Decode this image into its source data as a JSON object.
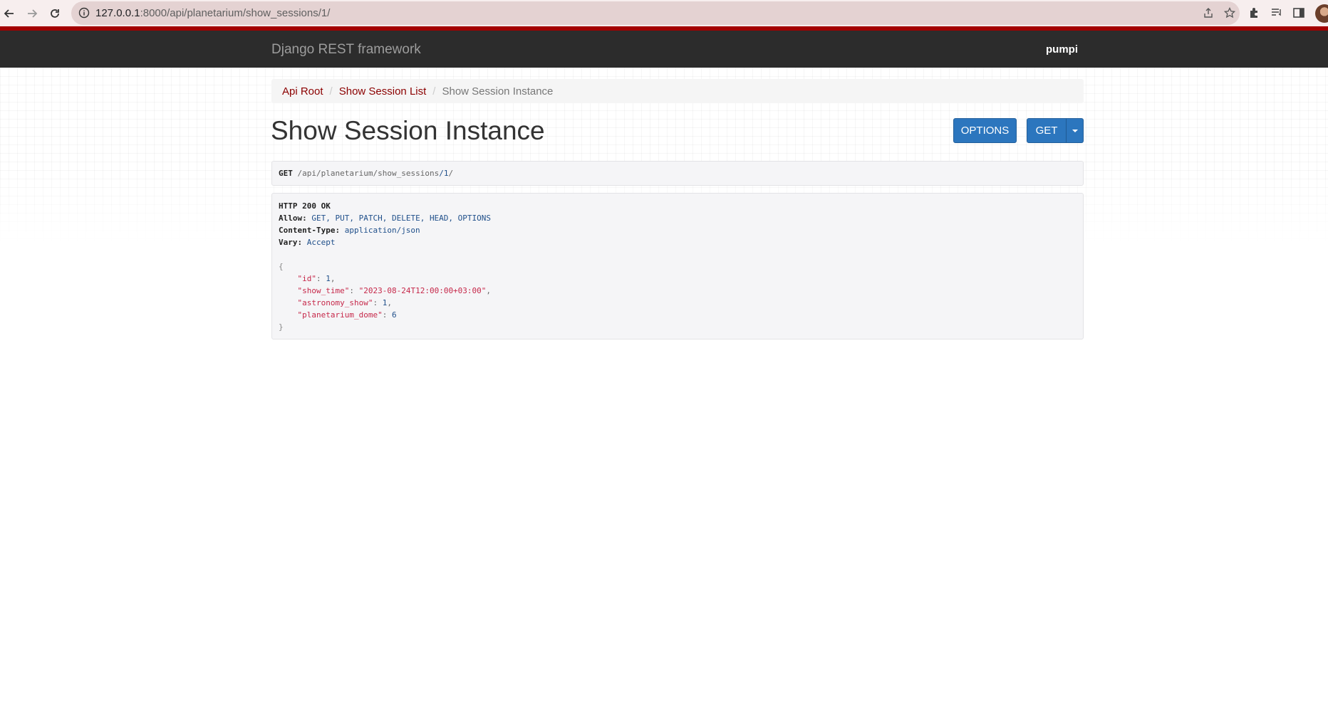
{
  "browser": {
    "url_host": "127.0.0.1",
    "url_rest": ":8000/api/planetarium/show_sessions/1/"
  },
  "navbar": {
    "brand": "Django REST framework",
    "user": "pumpi"
  },
  "breadcrumb": {
    "items": [
      {
        "label": "Api Root"
      },
      {
        "label": "Show Session List"
      }
    ],
    "separator": "/",
    "active": "Show Session Instance"
  },
  "page": {
    "title": "Show Session Instance"
  },
  "buttons": {
    "options": "OPTIONS",
    "get": "GET"
  },
  "request": {
    "method": "GET",
    "path_parts": [
      "/api",
      "/planetarium",
      "/show_sessions",
      "/1",
      "/"
    ]
  },
  "response": {
    "status": "HTTP 200 OK",
    "headers": [
      {
        "name": "Allow:",
        "value": "GET, PUT, PATCH, DELETE, HEAD, OPTIONS"
      },
      {
        "name": "Content-Type:",
        "value": "application/json"
      },
      {
        "name": "Vary:",
        "value": "Accept"
      }
    ],
    "body_open": "{",
    "body_close": "}",
    "fields": [
      {
        "key": "\"id\"",
        "value": "1",
        "value_type": "num",
        "comma": ","
      },
      {
        "key": "\"show_time\"",
        "value": "\"2023-08-24T12:00:00+03:00\"",
        "value_type": "str",
        "comma": ","
      },
      {
        "key": "\"astronomy_show\"",
        "value": "1",
        "value_type": "num",
        "comma": ","
      },
      {
        "key": "\"planetarium_dome\"",
        "value": "6",
        "value_type": "num",
        "comma": ""
      }
    ]
  },
  "colors": {
    "navbar_bg": "#2c2c2c",
    "accent_red": "#a30000",
    "link": "#8b0000",
    "button_primary": "#2c76be"
  }
}
